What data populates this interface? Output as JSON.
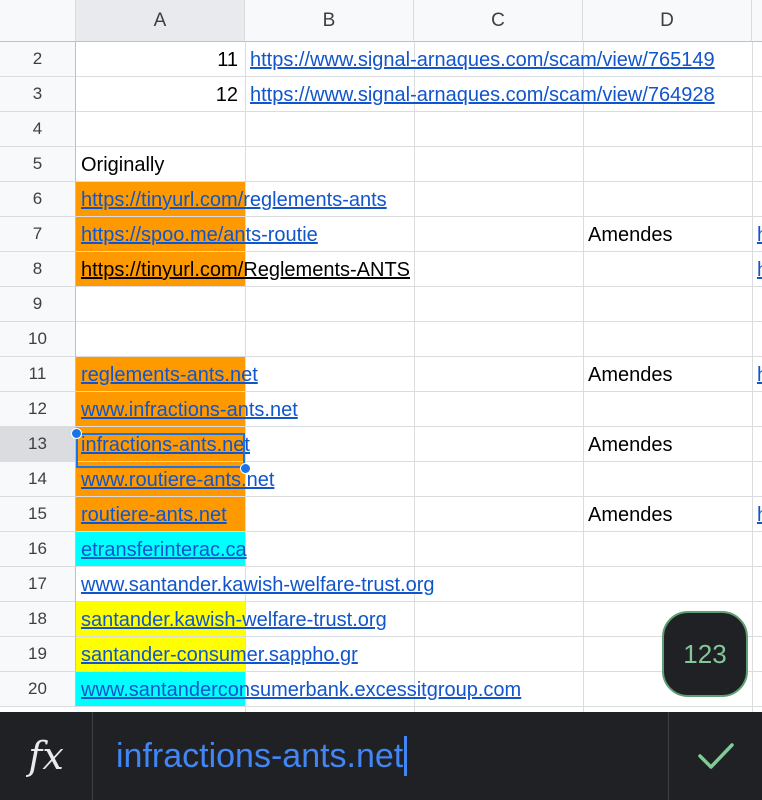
{
  "columns": [
    "A",
    "B",
    "C",
    "D"
  ],
  "selected_column": "A",
  "rows": [
    {
      "num": "2",
      "cells": [
        {
          "col": "A",
          "text": "11",
          "style": "number",
          "right": true
        },
        {
          "col": "B",
          "text": "https://www.signal-arnaques.com/scam/view/765149",
          "style": "link"
        }
      ]
    },
    {
      "num": "3",
      "cells": [
        {
          "col": "A",
          "text": "12",
          "style": "number",
          "right": true
        },
        {
          "col": "B",
          "text": "https://www.signal-arnaques.com/scam/view/764928",
          "style": "link"
        }
      ]
    },
    {
      "num": "4",
      "cells": []
    },
    {
      "num": "5",
      "cells": [
        {
          "col": "A",
          "text": "Originally",
          "style": "plain"
        }
      ]
    },
    {
      "num": "6",
      "fill": "#ff9900",
      "cells": [
        {
          "col": "A",
          "text": "https://tinyurl.com/reglements-ants",
          "style": "link"
        }
      ]
    },
    {
      "num": "7",
      "fill": "#ff9900",
      "cells": [
        {
          "col": "A",
          "text": "https://spoo.me/ants-routie",
          "style": "link"
        },
        {
          "col": "D",
          "text": "Amendes",
          "style": "plain"
        },
        {
          "col": "E",
          "text": "h",
          "style": "link"
        }
      ]
    },
    {
      "num": "8",
      "fill": "#ff9900",
      "cells": [
        {
          "col": "A",
          "text": "https://tinyurl.com/Reglements-ANTS",
          "style": "black-link"
        },
        {
          "col": "E",
          "text": "h",
          "style": "link"
        }
      ]
    },
    {
      "num": "9",
      "cells": []
    },
    {
      "num": "10",
      "cells": []
    },
    {
      "num": "11",
      "fill": "#ff9900",
      "cells": [
        {
          "col": "A",
          "text": "reglements-ants.net",
          "style": "link"
        },
        {
          "col": "D",
          "text": "Amendes",
          "style": "plain"
        },
        {
          "col": "E",
          "text": "h",
          "style": "link"
        }
      ]
    },
    {
      "num": "12",
      "fill": "#ff9900",
      "cells": [
        {
          "col": "A",
          "text": "www.infractions-ants.net",
          "style": "link"
        }
      ]
    },
    {
      "num": "13",
      "fill": "#ff9900",
      "cells": [
        {
          "col": "A",
          "text": "infractions-ants.net",
          "style": "link"
        },
        {
          "col": "D",
          "text": "Amendes",
          "style": "plain"
        }
      ]
    },
    {
      "num": "14",
      "fill": "#ff9900",
      "cells": [
        {
          "col": "A",
          "text": "www.routiere-ants.net",
          "style": "link"
        }
      ]
    },
    {
      "num": "15",
      "fill": "#ff9900",
      "cells": [
        {
          "col": "A",
          "text": "routiere-ants.net",
          "style": "link"
        },
        {
          "col": "D",
          "text": "Amendes",
          "style": "plain"
        },
        {
          "col": "E",
          "text": "h",
          "style": "link"
        }
      ]
    },
    {
      "num": "16",
      "fill": "#00ffff",
      "cells": [
        {
          "col": "A",
          "text": "etransferinterac.ca",
          "style": "link"
        }
      ]
    },
    {
      "num": "17",
      "cells": [
        {
          "col": "A",
          "text": "www.santander.kawish-welfare-trust.org",
          "style": "link"
        }
      ]
    },
    {
      "num": "18",
      "fill": "#ffff00",
      "cells": [
        {
          "col": "A",
          "text": "santander.kawish-welfare-trust.org",
          "style": "link"
        }
      ]
    },
    {
      "num": "19",
      "fill": "#ffff00",
      "cells": [
        {
          "col": "A",
          "text": "santander-consumer.sappho.gr",
          "style": "link"
        }
      ]
    },
    {
      "num": "20",
      "fill": "#00ffff",
      "cells": [
        {
          "col": "A",
          "text": "www.santanderconsumerbank.excessitgroup.com",
          "style": "link"
        }
      ]
    }
  ],
  "selected_row": "13",
  "keyboard_toggle": {
    "label": "123"
  },
  "formula_bar": {
    "fx_label": "fx",
    "value": "infractions-ants.net",
    "confirm_icon": "check-icon"
  },
  "colors": {
    "link": "#1155cc",
    "selection": "#1a73e8",
    "formula_text": "#4285f4",
    "confirm": "#81c995"
  }
}
